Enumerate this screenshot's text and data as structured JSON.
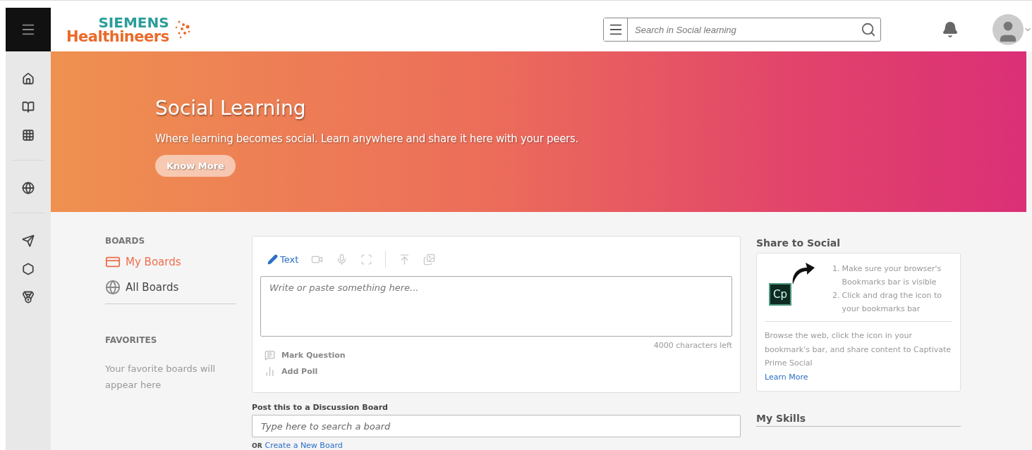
{
  "header": {
    "logo": {
      "top": "SIEMENS",
      "bottom": "Healthineers"
    },
    "search": {
      "placeholder": "Search in Social learning"
    }
  },
  "banner": {
    "title": "Social Learning",
    "subtitle": "Where learning becomes social. Learn anywhere and share it here with your peers.",
    "button": "Know More"
  },
  "boards": {
    "heading": "BOARDS",
    "items": [
      {
        "label": "My Boards",
        "kind": "mine",
        "selected": true
      },
      {
        "label": "All Boards",
        "kind": "all",
        "selected": false
      }
    ]
  },
  "favorites": {
    "heading": "FAVORITES",
    "empty_text": "Your favorite boards will appear here"
  },
  "composer": {
    "tabs": [
      {
        "label": "Text",
        "selected": true
      }
    ],
    "placeholder": "Write or paste something here...",
    "counter": "4000 characters left",
    "options": [
      {
        "label": "Mark Question",
        "kind": "question"
      },
      {
        "label": "Add Poll",
        "kind": "poll"
      }
    ]
  },
  "post_to": {
    "label": "Post this to a Discussion Board",
    "placeholder": "Type here to search a board",
    "or": "OR",
    "link": "Create a New Board"
  },
  "share": {
    "title": "Share to Social",
    "steps": [
      {
        "marker": "1.",
        "text": "Make sure your browser's Bookmarks bar is visible"
      },
      {
        "marker": "2.",
        "text": "Click and drag the icon to your bookmarks bar"
      }
    ],
    "app_icon": "Cp",
    "description": "Browse the web, click the icon in your bookmark's bar, and share content to Captivate Prime Social",
    "link": "Learn More"
  },
  "skills": {
    "title": "My Skills"
  }
}
